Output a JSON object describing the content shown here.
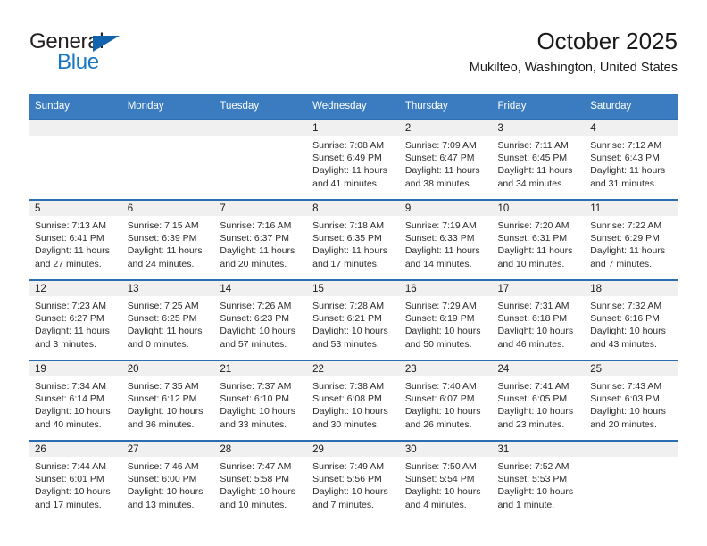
{
  "brand": {
    "name_top": "General",
    "name_bottom": "Blue",
    "triangle_icon": "triangle-icon",
    "accent_blue": "#1777c2",
    "dark": "#231f20"
  },
  "header": {
    "title": "October 2025",
    "subtitle": "Mukilteo, Washington, United States"
  },
  "colors": {
    "header_blue": "#3b7cc0",
    "row_divider_blue": "#2c6cb0",
    "daynum_band": "#f0f0f0",
    "text": "#1a1a1a"
  },
  "weekdays": [
    "Sunday",
    "Monday",
    "Tuesday",
    "Wednesday",
    "Thursday",
    "Friday",
    "Saturday"
  ],
  "weeks": [
    [
      {
        "day": "",
        "sunrise": "",
        "sunset": "",
        "daylight": ""
      },
      {
        "day": "",
        "sunrise": "",
        "sunset": "",
        "daylight": ""
      },
      {
        "day": "",
        "sunrise": "",
        "sunset": "",
        "daylight": ""
      },
      {
        "day": "1",
        "sunrise": "Sunrise: 7:08 AM",
        "sunset": "Sunset: 6:49 PM",
        "daylight": "Daylight: 11 hours and 41 minutes."
      },
      {
        "day": "2",
        "sunrise": "Sunrise: 7:09 AM",
        "sunset": "Sunset: 6:47 PM",
        "daylight": "Daylight: 11 hours and 38 minutes."
      },
      {
        "day": "3",
        "sunrise": "Sunrise: 7:11 AM",
        "sunset": "Sunset: 6:45 PM",
        "daylight": "Daylight: 11 hours and 34 minutes."
      },
      {
        "day": "4",
        "sunrise": "Sunrise: 7:12 AM",
        "sunset": "Sunset: 6:43 PM",
        "daylight": "Daylight: 11 hours and 31 minutes."
      }
    ],
    [
      {
        "day": "5",
        "sunrise": "Sunrise: 7:13 AM",
        "sunset": "Sunset: 6:41 PM",
        "daylight": "Daylight: 11 hours and 27 minutes."
      },
      {
        "day": "6",
        "sunrise": "Sunrise: 7:15 AM",
        "sunset": "Sunset: 6:39 PM",
        "daylight": "Daylight: 11 hours and 24 minutes."
      },
      {
        "day": "7",
        "sunrise": "Sunrise: 7:16 AM",
        "sunset": "Sunset: 6:37 PM",
        "daylight": "Daylight: 11 hours and 20 minutes."
      },
      {
        "day": "8",
        "sunrise": "Sunrise: 7:18 AM",
        "sunset": "Sunset: 6:35 PM",
        "daylight": "Daylight: 11 hours and 17 minutes."
      },
      {
        "day": "9",
        "sunrise": "Sunrise: 7:19 AM",
        "sunset": "Sunset: 6:33 PM",
        "daylight": "Daylight: 11 hours and 14 minutes."
      },
      {
        "day": "10",
        "sunrise": "Sunrise: 7:20 AM",
        "sunset": "Sunset: 6:31 PM",
        "daylight": "Daylight: 11 hours and 10 minutes."
      },
      {
        "day": "11",
        "sunrise": "Sunrise: 7:22 AM",
        "sunset": "Sunset: 6:29 PM",
        "daylight": "Daylight: 11 hours and 7 minutes."
      }
    ],
    [
      {
        "day": "12",
        "sunrise": "Sunrise: 7:23 AM",
        "sunset": "Sunset: 6:27 PM",
        "daylight": "Daylight: 11 hours and 3 minutes."
      },
      {
        "day": "13",
        "sunrise": "Sunrise: 7:25 AM",
        "sunset": "Sunset: 6:25 PM",
        "daylight": "Daylight: 11 hours and 0 minutes."
      },
      {
        "day": "14",
        "sunrise": "Sunrise: 7:26 AM",
        "sunset": "Sunset: 6:23 PM",
        "daylight": "Daylight: 10 hours and 57 minutes."
      },
      {
        "day": "15",
        "sunrise": "Sunrise: 7:28 AM",
        "sunset": "Sunset: 6:21 PM",
        "daylight": "Daylight: 10 hours and 53 minutes."
      },
      {
        "day": "16",
        "sunrise": "Sunrise: 7:29 AM",
        "sunset": "Sunset: 6:19 PM",
        "daylight": "Daylight: 10 hours and 50 minutes."
      },
      {
        "day": "17",
        "sunrise": "Sunrise: 7:31 AM",
        "sunset": "Sunset: 6:18 PM",
        "daylight": "Daylight: 10 hours and 46 minutes."
      },
      {
        "day": "18",
        "sunrise": "Sunrise: 7:32 AM",
        "sunset": "Sunset: 6:16 PM",
        "daylight": "Daylight: 10 hours and 43 minutes."
      }
    ],
    [
      {
        "day": "19",
        "sunrise": "Sunrise: 7:34 AM",
        "sunset": "Sunset: 6:14 PM",
        "daylight": "Daylight: 10 hours and 40 minutes."
      },
      {
        "day": "20",
        "sunrise": "Sunrise: 7:35 AM",
        "sunset": "Sunset: 6:12 PM",
        "daylight": "Daylight: 10 hours and 36 minutes."
      },
      {
        "day": "21",
        "sunrise": "Sunrise: 7:37 AM",
        "sunset": "Sunset: 6:10 PM",
        "daylight": "Daylight: 10 hours and 33 minutes."
      },
      {
        "day": "22",
        "sunrise": "Sunrise: 7:38 AM",
        "sunset": "Sunset: 6:08 PM",
        "daylight": "Daylight: 10 hours and 30 minutes."
      },
      {
        "day": "23",
        "sunrise": "Sunrise: 7:40 AM",
        "sunset": "Sunset: 6:07 PM",
        "daylight": "Daylight: 10 hours and 26 minutes."
      },
      {
        "day": "24",
        "sunrise": "Sunrise: 7:41 AM",
        "sunset": "Sunset: 6:05 PM",
        "daylight": "Daylight: 10 hours and 23 minutes."
      },
      {
        "day": "25",
        "sunrise": "Sunrise: 7:43 AM",
        "sunset": "Sunset: 6:03 PM",
        "daylight": "Daylight: 10 hours and 20 minutes."
      }
    ],
    [
      {
        "day": "26",
        "sunrise": "Sunrise: 7:44 AM",
        "sunset": "Sunset: 6:01 PM",
        "daylight": "Daylight: 10 hours and 17 minutes."
      },
      {
        "day": "27",
        "sunrise": "Sunrise: 7:46 AM",
        "sunset": "Sunset: 6:00 PM",
        "daylight": "Daylight: 10 hours and 13 minutes."
      },
      {
        "day": "28",
        "sunrise": "Sunrise: 7:47 AM",
        "sunset": "Sunset: 5:58 PM",
        "daylight": "Daylight: 10 hours and 10 minutes."
      },
      {
        "day": "29",
        "sunrise": "Sunrise: 7:49 AM",
        "sunset": "Sunset: 5:56 PM",
        "daylight": "Daylight: 10 hours and 7 minutes."
      },
      {
        "day": "30",
        "sunrise": "Sunrise: 7:50 AM",
        "sunset": "Sunset: 5:54 PM",
        "daylight": "Daylight: 10 hours and 4 minutes."
      },
      {
        "day": "31",
        "sunrise": "Sunrise: 7:52 AM",
        "sunset": "Sunset: 5:53 PM",
        "daylight": "Daylight: 10 hours and 1 minute."
      },
      {
        "day": "",
        "sunrise": "",
        "sunset": "",
        "daylight": ""
      }
    ]
  ]
}
